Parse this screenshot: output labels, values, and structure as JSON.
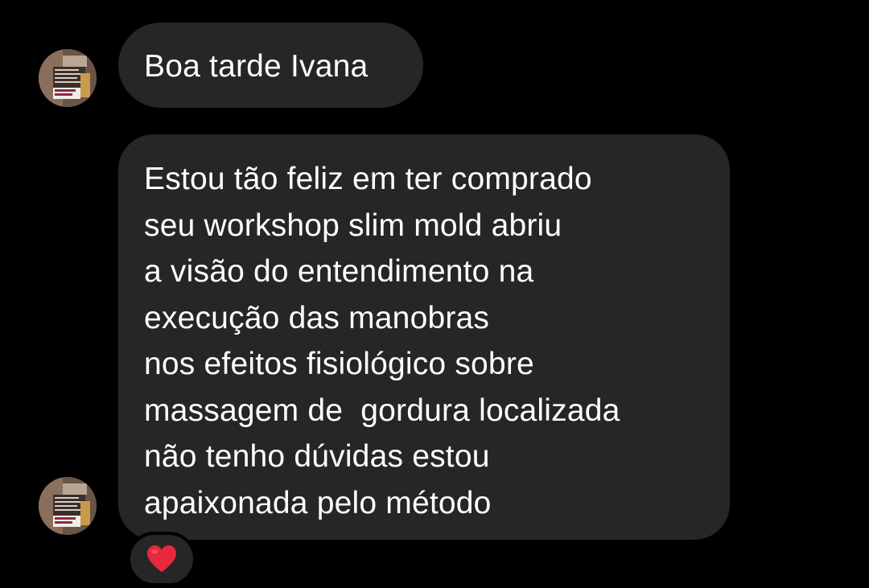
{
  "conversation": {
    "messages": [
      {
        "sender": "other",
        "text": "Boa tarde Ivana"
      },
      {
        "sender": "other",
        "lines": [
          "Estou tão feliz em ter comprado",
          "seu workshop slim mold abriu",
          "a visão do entendimento na",
          "execução das manobras",
          "nos efeitos fisiológico sobre",
          "massagem de  gordura localizada",
          "não tenho dúvidas estou",
          "apaixonada pelo método"
        ],
        "reaction": "heart"
      }
    ]
  },
  "colors": {
    "background": "#000000",
    "bubble": "#262626",
    "text": "#ffffff",
    "heart": "#e8283b"
  },
  "icons": {
    "avatar": "profile-avatar-photo",
    "reaction": "heart-icon"
  }
}
